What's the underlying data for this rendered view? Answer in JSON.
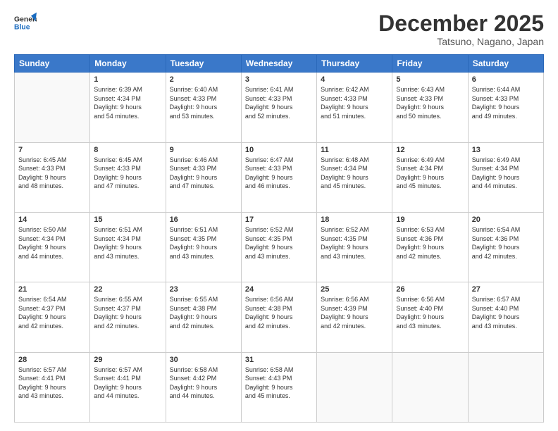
{
  "header": {
    "logo_line1": "General",
    "logo_line2": "Blue",
    "month_title": "December 2025",
    "location": "Tatsuno, Nagano, Japan"
  },
  "weekdays": [
    "Sunday",
    "Monday",
    "Tuesday",
    "Wednesday",
    "Thursday",
    "Friday",
    "Saturday"
  ],
  "weeks": [
    [
      {
        "day": "",
        "info": ""
      },
      {
        "day": "1",
        "info": "Sunrise: 6:39 AM\nSunset: 4:34 PM\nDaylight: 9 hours\nand 54 minutes."
      },
      {
        "day": "2",
        "info": "Sunrise: 6:40 AM\nSunset: 4:33 PM\nDaylight: 9 hours\nand 53 minutes."
      },
      {
        "day": "3",
        "info": "Sunrise: 6:41 AM\nSunset: 4:33 PM\nDaylight: 9 hours\nand 52 minutes."
      },
      {
        "day": "4",
        "info": "Sunrise: 6:42 AM\nSunset: 4:33 PM\nDaylight: 9 hours\nand 51 minutes."
      },
      {
        "day": "5",
        "info": "Sunrise: 6:43 AM\nSunset: 4:33 PM\nDaylight: 9 hours\nand 50 minutes."
      },
      {
        "day": "6",
        "info": "Sunrise: 6:44 AM\nSunset: 4:33 PM\nDaylight: 9 hours\nand 49 minutes."
      }
    ],
    [
      {
        "day": "7",
        "info": "Sunrise: 6:45 AM\nSunset: 4:33 PM\nDaylight: 9 hours\nand 48 minutes."
      },
      {
        "day": "8",
        "info": "Sunrise: 6:45 AM\nSunset: 4:33 PM\nDaylight: 9 hours\nand 47 minutes."
      },
      {
        "day": "9",
        "info": "Sunrise: 6:46 AM\nSunset: 4:33 PM\nDaylight: 9 hours\nand 47 minutes."
      },
      {
        "day": "10",
        "info": "Sunrise: 6:47 AM\nSunset: 4:33 PM\nDaylight: 9 hours\nand 46 minutes."
      },
      {
        "day": "11",
        "info": "Sunrise: 6:48 AM\nSunset: 4:34 PM\nDaylight: 9 hours\nand 45 minutes."
      },
      {
        "day": "12",
        "info": "Sunrise: 6:49 AM\nSunset: 4:34 PM\nDaylight: 9 hours\nand 45 minutes."
      },
      {
        "day": "13",
        "info": "Sunrise: 6:49 AM\nSunset: 4:34 PM\nDaylight: 9 hours\nand 44 minutes."
      }
    ],
    [
      {
        "day": "14",
        "info": "Sunrise: 6:50 AM\nSunset: 4:34 PM\nDaylight: 9 hours\nand 44 minutes."
      },
      {
        "day": "15",
        "info": "Sunrise: 6:51 AM\nSunset: 4:34 PM\nDaylight: 9 hours\nand 43 minutes."
      },
      {
        "day": "16",
        "info": "Sunrise: 6:51 AM\nSunset: 4:35 PM\nDaylight: 9 hours\nand 43 minutes."
      },
      {
        "day": "17",
        "info": "Sunrise: 6:52 AM\nSunset: 4:35 PM\nDaylight: 9 hours\nand 43 minutes."
      },
      {
        "day": "18",
        "info": "Sunrise: 6:52 AM\nSunset: 4:35 PM\nDaylight: 9 hours\nand 43 minutes."
      },
      {
        "day": "19",
        "info": "Sunrise: 6:53 AM\nSunset: 4:36 PM\nDaylight: 9 hours\nand 42 minutes."
      },
      {
        "day": "20",
        "info": "Sunrise: 6:54 AM\nSunset: 4:36 PM\nDaylight: 9 hours\nand 42 minutes."
      }
    ],
    [
      {
        "day": "21",
        "info": "Sunrise: 6:54 AM\nSunset: 4:37 PM\nDaylight: 9 hours\nand 42 minutes."
      },
      {
        "day": "22",
        "info": "Sunrise: 6:55 AM\nSunset: 4:37 PM\nDaylight: 9 hours\nand 42 minutes."
      },
      {
        "day": "23",
        "info": "Sunrise: 6:55 AM\nSunset: 4:38 PM\nDaylight: 9 hours\nand 42 minutes."
      },
      {
        "day": "24",
        "info": "Sunrise: 6:56 AM\nSunset: 4:38 PM\nDaylight: 9 hours\nand 42 minutes."
      },
      {
        "day": "25",
        "info": "Sunrise: 6:56 AM\nSunset: 4:39 PM\nDaylight: 9 hours\nand 42 minutes."
      },
      {
        "day": "26",
        "info": "Sunrise: 6:56 AM\nSunset: 4:40 PM\nDaylight: 9 hours\nand 43 minutes."
      },
      {
        "day": "27",
        "info": "Sunrise: 6:57 AM\nSunset: 4:40 PM\nDaylight: 9 hours\nand 43 minutes."
      }
    ],
    [
      {
        "day": "28",
        "info": "Sunrise: 6:57 AM\nSunset: 4:41 PM\nDaylight: 9 hours\nand 43 minutes."
      },
      {
        "day": "29",
        "info": "Sunrise: 6:57 AM\nSunset: 4:41 PM\nDaylight: 9 hours\nand 44 minutes."
      },
      {
        "day": "30",
        "info": "Sunrise: 6:58 AM\nSunset: 4:42 PM\nDaylight: 9 hours\nand 44 minutes."
      },
      {
        "day": "31",
        "info": "Sunrise: 6:58 AM\nSunset: 4:43 PM\nDaylight: 9 hours\nand 45 minutes."
      },
      {
        "day": "",
        "info": ""
      },
      {
        "day": "",
        "info": ""
      },
      {
        "day": "",
        "info": ""
      }
    ]
  ]
}
